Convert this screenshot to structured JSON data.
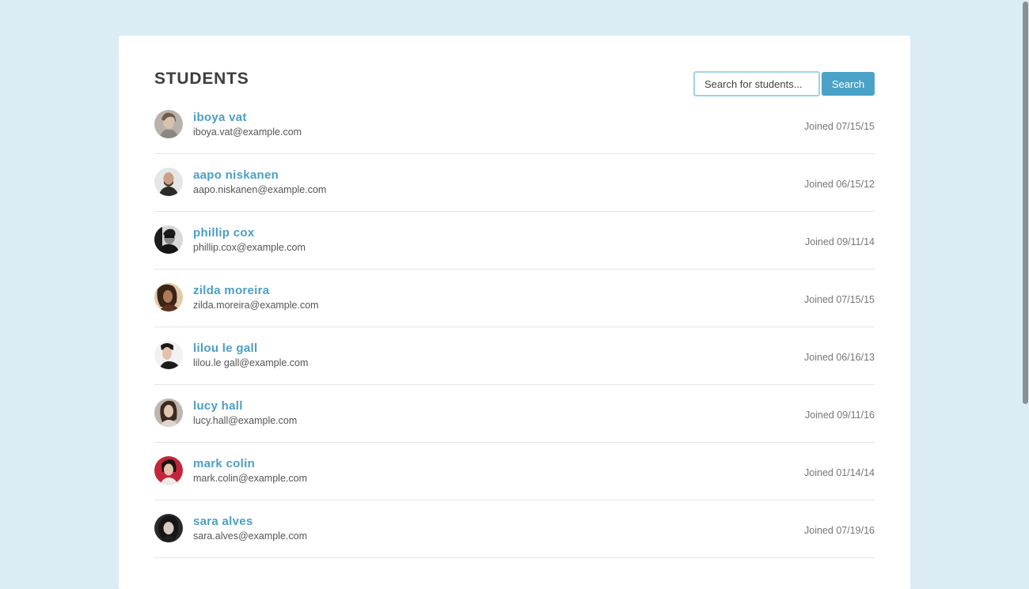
{
  "page": {
    "title": "STUDENTS"
  },
  "search": {
    "placeholder": "Search for students...",
    "button_label": "Search"
  },
  "colors": {
    "background": "#dcecf4",
    "accent": "#4a9fc6",
    "button": "#4aa2c7"
  },
  "students": [
    {
      "name": "iboya vat",
      "email": "iboya.vat@example.com",
      "joined": "Joined 07/15/15",
      "avatar_icon": "avatar-photo"
    },
    {
      "name": "aapo niskanen",
      "email": "aapo.niskanen@example.com",
      "joined": "Joined 06/15/12",
      "avatar_icon": "avatar-photo"
    },
    {
      "name": "phillip cox",
      "email": "phillip.cox@example.com",
      "joined": "Joined 09/11/14",
      "avatar_icon": "avatar-photo"
    },
    {
      "name": "zilda moreira",
      "email": "zilda.moreira@example.com",
      "joined": "Joined 07/15/15",
      "avatar_icon": "avatar-photo"
    },
    {
      "name": "lilou le gall",
      "email": "lilou.le gall@example.com",
      "joined": "Joined 06/16/13",
      "avatar_icon": "avatar-photo"
    },
    {
      "name": "lucy hall",
      "email": "lucy.hall@example.com",
      "joined": "Joined 09/11/16",
      "avatar_icon": "avatar-photo"
    },
    {
      "name": "mark colin",
      "email": "mark.colin@example.com",
      "joined": "Joined 01/14/14",
      "avatar_icon": "avatar-photo"
    },
    {
      "name": "sara alves",
      "email": "sara.alves@example.com",
      "joined": "Joined 07/19/16",
      "avatar_icon": "avatar-photo"
    }
  ]
}
